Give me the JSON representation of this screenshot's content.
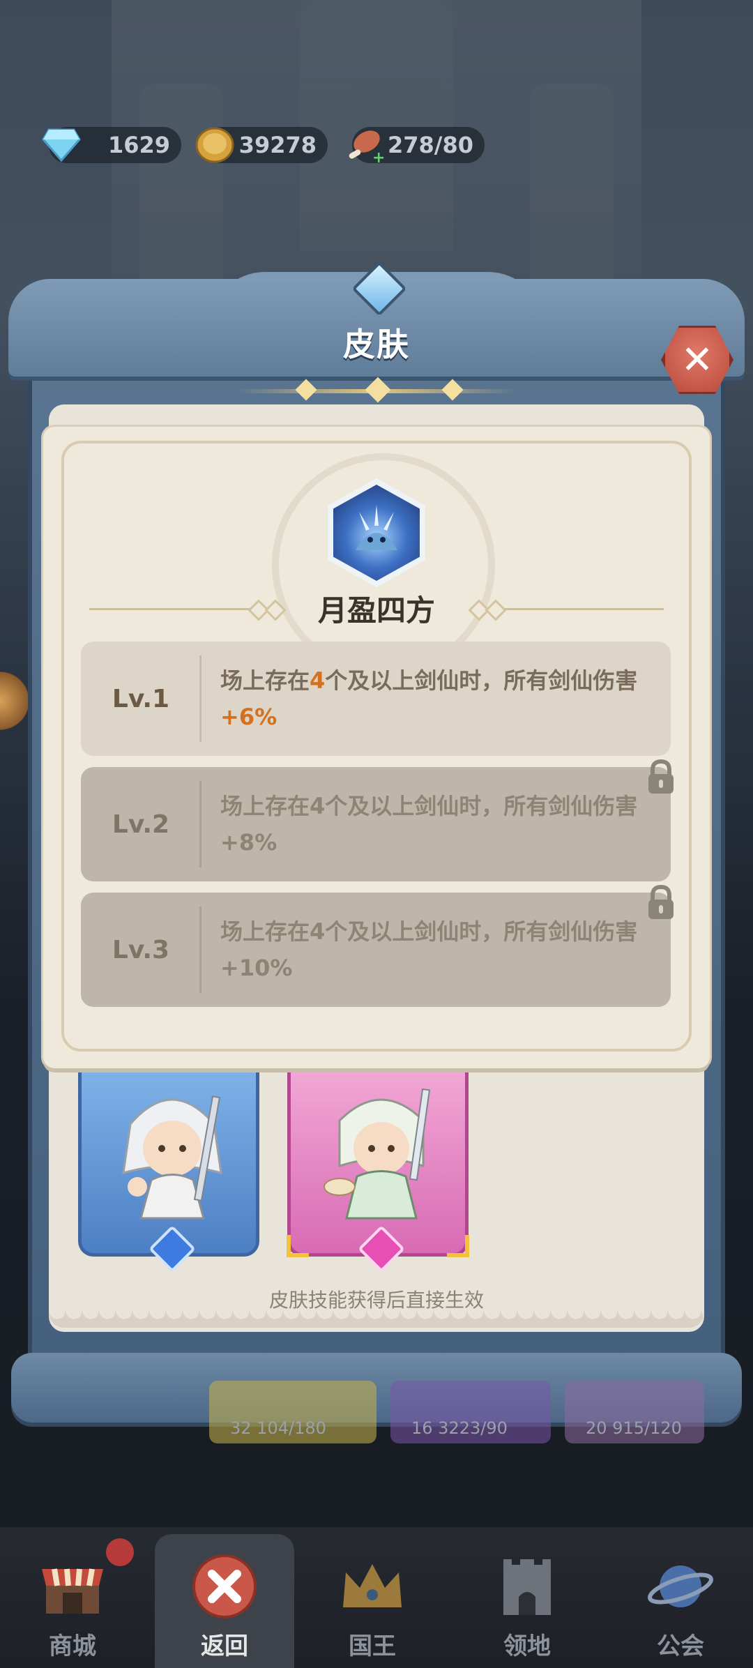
{
  "resources": [
    {
      "icon": "diamond-icon",
      "value": "1629"
    },
    {
      "icon": "gold-coin-icon",
      "value": "39278"
    },
    {
      "icon": "meat-stamina-icon",
      "value": "278/80"
    }
  ],
  "dialog": {
    "title": "皮肤",
    "close_icon": "close-icon"
  },
  "skill": {
    "name": "月盈四方",
    "levels": [
      {
        "label": "Lv.1",
        "desc_prefix": "场上存在",
        "count": "4",
        "desc_middle": "个及以上剑仙时，所有剑仙伤害",
        "bonus": "+6%",
        "locked": false
      },
      {
        "label": "Lv.2",
        "desc": "场上存在4个及以上剑仙时，所有剑仙伤害+8%",
        "locked": true
      },
      {
        "label": "Lv.3",
        "desc": "场上存在4个及以上剑仙时，所有剑仙伤害+10%",
        "locked": true
      }
    ]
  },
  "skins": [
    {
      "name": "skin-white-swordsman",
      "frame_color": "#5f93d6",
      "gem_color": "#3d7be0"
    },
    {
      "name": "skin-tea-swordsman",
      "frame_color": "#e58ac4",
      "gem_color": "#e84fb4",
      "selected": true
    }
  ],
  "skin_note": "皮肤技能获得后直接生效",
  "under_cards": [
    {
      "text": "32 104/180"
    },
    {
      "text": "16 3223/90"
    },
    {
      "text": "20 915/120"
    }
  ],
  "nav": [
    {
      "label": "商城",
      "icon": "shop-icon",
      "badge": true
    },
    {
      "label": "返回",
      "icon": "back-close-icon",
      "active": true
    },
    {
      "label": "国王",
      "icon": "crown-icon"
    },
    {
      "label": "领地",
      "icon": "castle-icon"
    },
    {
      "label": "公会",
      "icon": "planet-icon"
    }
  ],
  "colors": {
    "accent_orange": "#d2711f",
    "close_red": "#c9574a",
    "frame_blue": "#5f7c99"
  }
}
